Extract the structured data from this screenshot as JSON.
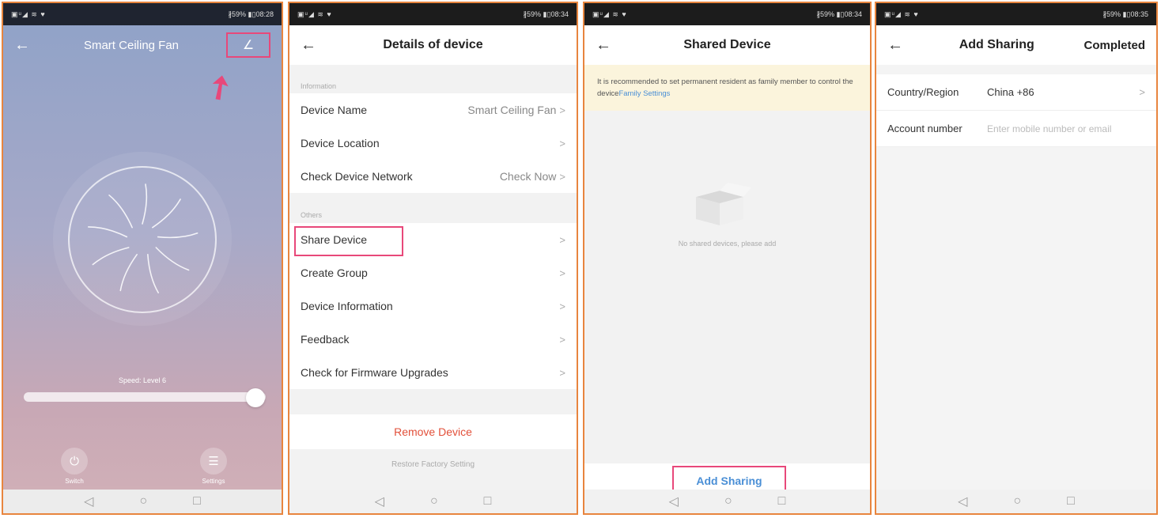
{
  "accent_color": "#e8487a",
  "link_color": "#4a8fd6",
  "danger_color": "#e2503a",
  "frame_color": "#e8853e",
  "screen1": {
    "status_left": "▣ᵘ◢ ≋ ♥",
    "status_right": "∦59% ▮▯08:28",
    "title": "Smart Ceiling Fan",
    "speed_label": "Speed: Level 6",
    "speed_level": 6,
    "switch_label": "Switch",
    "settings_label": "Settings"
  },
  "screen2": {
    "status_left": "▣ᵘ◢ ≋ ♥",
    "status_right": "∦59% ▮▯08:34",
    "title": "Details of device",
    "section_information": "Information",
    "section_others": "Others",
    "info_rows": [
      {
        "label": "Device Name",
        "value": "Smart Ceiling Fan"
      },
      {
        "label": "Device Location",
        "value": ""
      },
      {
        "label": "Check Device Network",
        "value": "Check Now"
      }
    ],
    "other_rows": [
      {
        "label": "Share Device"
      },
      {
        "label": "Create Group"
      },
      {
        "label": "Device Information"
      },
      {
        "label": "Feedback"
      },
      {
        "label": "Check for Firmware Upgrades"
      }
    ],
    "remove_label": "Remove Device",
    "restore_label": "Restore Factory Setting"
  },
  "screen3": {
    "status_left": "▣ᵘ◢ ≋ ♥",
    "status_right": "∦59% ▮▯08:34",
    "title": "Shared Device",
    "banner_text": "It is recommended to set permanent resident as family member to control the device",
    "banner_link": "Family Settings",
    "empty_text": "No shared devices, please add",
    "add_sharing_label": "Add Sharing"
  },
  "screen4": {
    "status_left": "▣ᵘ◢ ≋ ♥",
    "status_right": "∦59% ▮▯08:35",
    "title": "Add Sharing",
    "completed_label": "Completed",
    "country_label": "Country/Region",
    "country_value": "China +86",
    "account_label": "Account number",
    "account_placeholder": "Enter mobile number or email"
  }
}
